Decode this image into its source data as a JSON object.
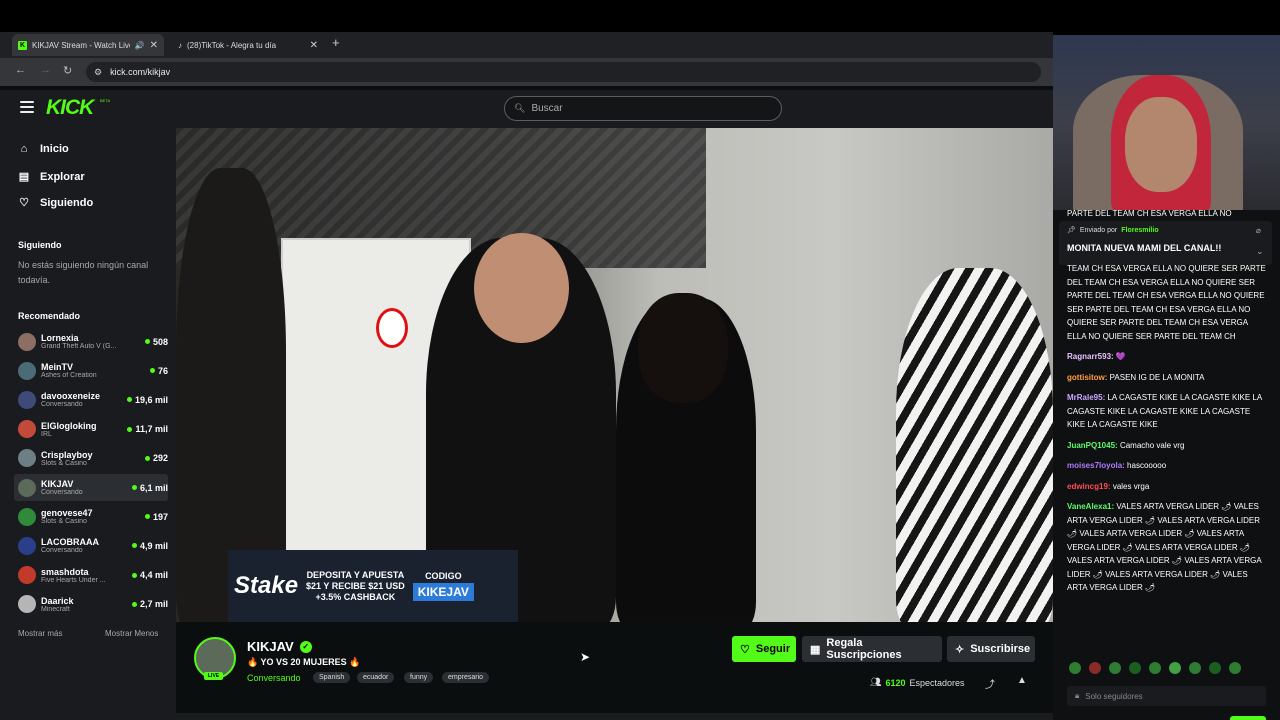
{
  "browser": {
    "tabs": [
      {
        "title": "KIKJAV Stream - Watch Live",
        "favicon": "kick-icon"
      },
      {
        "title": "(28)TikTok - Alegra tu día",
        "favicon": "tiktok-icon"
      }
    ],
    "url": "kick.com/kikjav"
  },
  "header": {
    "logo": "KICK",
    "beta": "BETA",
    "search_placeholder": "Buscar"
  },
  "sidebar": {
    "nav": [
      {
        "label": "Inicio",
        "icon": "home-icon"
      },
      {
        "label": "Explorar",
        "icon": "compass-icon"
      },
      {
        "label": "Siguiendo",
        "icon": "heart-icon"
      }
    ],
    "following_heading": "Siguiendo",
    "following_empty": "No estás siguiendo ningún canal todavía.",
    "recommended_heading": "Recomendado",
    "channels": [
      {
        "name": "Lornexia",
        "category": "Grand Theft Auto V (G...",
        "viewers": "508",
        "color": "#8a6f62"
      },
      {
        "name": "MeinTV",
        "category": "Ashes of Creation",
        "viewers": "76",
        "color": "#4b6b77"
      },
      {
        "name": "davooxeneize",
        "category": "Conversando",
        "viewers": "19,6 mil",
        "color": "#3e4a78"
      },
      {
        "name": "ElGlogloking",
        "category": "IRL",
        "viewers": "11,7 mil",
        "color": "#c24a3a"
      },
      {
        "name": "Crisplayboy",
        "category": "Slots & Casino",
        "viewers": "292",
        "color": "#6d7e84"
      },
      {
        "name": "KIKJAV",
        "category": "Conversando",
        "viewers": "6,1 mil",
        "color": "#5b6a59"
      },
      {
        "name": "genovese47",
        "category": "Slots & Casino",
        "viewers": "197",
        "color": "#2f8a3a"
      },
      {
        "name": "LACOBRAAA",
        "category": "Conversando",
        "viewers": "4,9 mil",
        "color": "#2a3e8a"
      },
      {
        "name": "smashdota",
        "category": "Five Hearts Under ...",
        "viewers": "4,4 mil",
        "color": "#c23a2a"
      },
      {
        "name": "Daarick",
        "category": "Minecraft",
        "viewers": "2,7 mil",
        "color": "#b5b5b5"
      }
    ],
    "show_more": "Mostrar más",
    "show_less": "Mostrar Menos"
  },
  "video": {
    "ad": {
      "brand": "Stake",
      "line1": "DEPOSITA Y APUESTA",
      "line2": "$21 Y RECIBE $21 USD",
      "line3": "+3.5% CASHBACK",
      "code_label": "CODIGO",
      "code": "KIKEJAV"
    }
  },
  "channel": {
    "name": "KIKJAV",
    "live": "LIVE",
    "title": "🔥 YO VS 20 MUJERES 🔥",
    "category": "Conversando",
    "tags": [
      "Spanish",
      "ecuador",
      "funny",
      "empresario"
    ],
    "follow": "Seguir",
    "gift": "Regala Suscripciones",
    "subscribe": "Suscribirse",
    "viewers": "6120",
    "viewers_label": "Espectadores"
  },
  "chat": {
    "cutoff_line": "PARTE DEL TEAM CH ESA VERGA ELLA NO",
    "pinned": {
      "sent_by": "Enviado por",
      "user": "Floresmilio",
      "message": "MONITA NUEVA MAMI DEL CANAL!!"
    },
    "messages": [
      {
        "user": "",
        "text": "TEAM CH ESA VERGA ELLA NO QUIERE SER PARTE DEL TEAM CH ESA VERGA ELLA NO QUIERE SER PARTE DEL TEAM CH ESA VERGA ELLA NO QUIERE SER PARTE DEL TEAM CH ESA VERGA ELLA NO QUIERE SER PARTE DEL TEAM CH ESA VERGA ELLA NO QUIERE SER PARTE DEL TEAM CH",
        "color": "#ffffff"
      },
      {
        "user": "Ragnarr593:",
        "text": "💜",
        "color": "#e8c3ff"
      },
      {
        "user": "gottisitow:",
        "text": "PASEN IG DE LA MONITA",
        "color": "#ff9f43"
      },
      {
        "user": "MrRale95:",
        "text": "LA CAGASTE KIKE LA CAGASTE KIKE LA CAGASTE KIKE LA CAGASTE KIKE LA CAGASTE KIKE LA CAGASTE KIKE",
        "color": "#c9a7ff"
      },
      {
        "user": "JuanPQ1045:",
        "text": "Camacho vale vrg",
        "color": "#5dfc6a"
      },
      {
        "user": "moises7loyola:",
        "text": "hascooooo",
        "color": "#b07bff"
      },
      {
        "user": "edwincg19:",
        "text": "vales vrga",
        "color": "#ff4d5a"
      },
      {
        "user": "VaneAlexa1:",
        "text": "VALES ARTA VERGA LIDER 🌶 VALES ARTA VERGA LIDER 🌶 VALES ARTA VERGA LIDER 🌶 VALES ARTA VERGA LIDER 🌶 VALES ARTA VERGA LIDER 🌶 VALES ARTA VERGA LIDER 🌶 VALES ARTA VERGA LIDER 🌶 VALES ARTA VERGA LIDER 🌶 VALES ARTA VERGA LIDER 🌶 VALES ARTA VERGA LIDER 🌶",
        "color": "#5dfc6a"
      }
    ],
    "input_placeholder": "Solo seguidores"
  }
}
